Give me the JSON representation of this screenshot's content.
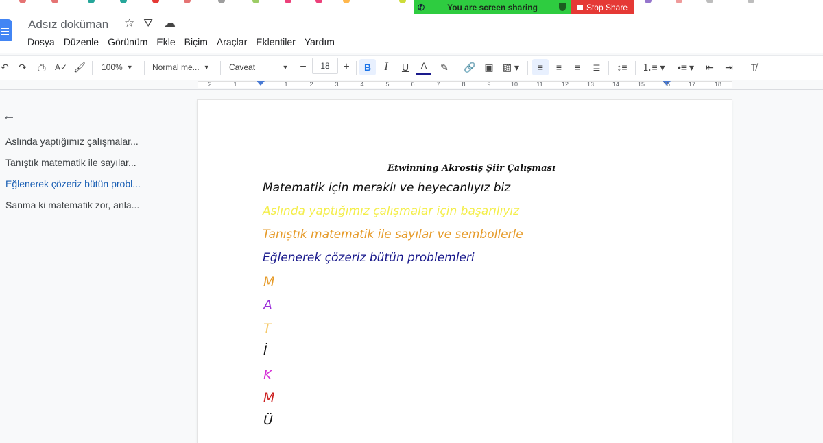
{
  "share_banner": {
    "status_text": "You are screen sharing",
    "stop_label": "Stop Share"
  },
  "header": {
    "doc_title": "Adsız doküman",
    "menu": [
      "Dosya",
      "Düzenle",
      "Görünüm",
      "Ekle",
      "Biçim",
      "Araçlar",
      "Eklentiler",
      "Yardım"
    ]
  },
  "toolbar": {
    "zoom": "100%",
    "style": "Normal me...",
    "font": "Caveat",
    "font_size": "18"
  },
  "ruler": {
    "labels": [
      "2",
      "1",
      "1",
      "2",
      "3",
      "4",
      "5",
      "6",
      "7",
      "8",
      "9",
      "10",
      "11",
      "12",
      "13",
      "14",
      "15",
      "16",
      "17",
      "18"
    ]
  },
  "outline": {
    "items": [
      "Aslında yaptığımız çalışmalar...",
      "Tanıştık matematik ile sayılar...",
      "Eğlenerek çözeriz bütün probl...",
      "Sanma ki matematik zor, anla..."
    ],
    "active_index": 2
  },
  "document": {
    "title": "Etwinning Akrostiş Şiir Çalışması",
    "lines": [
      {
        "text": "Matematik için meraklı ve heyecanlıyız biz",
        "color": "#111111"
      },
      {
        "text": "Aslında yaptığımız çalışmalar için başarılıyız",
        "color": "#f4ee4a"
      },
      {
        "text": "Tanıştık matematik ile sayılar ve sembollerle",
        "color": "#e69b2a"
      },
      {
        "text": "Eğlenerek  çözeriz bütün problemleri",
        "color": "#1a1a8c"
      }
    ],
    "letters": [
      {
        "text": "M",
        "color": "#e69b2a"
      },
      {
        "text": "A",
        "color": "#9b30d9"
      },
      {
        "text": "T",
        "color": "#f5c96a"
      },
      {
        "text": "İ",
        "color": "#111111"
      },
      {
        "text": "K",
        "color": "#d62fd6"
      },
      {
        "text": "M",
        "color": "#cc1f1f"
      },
      {
        "text": "Ü",
        "color": "#111111"
      }
    ]
  }
}
